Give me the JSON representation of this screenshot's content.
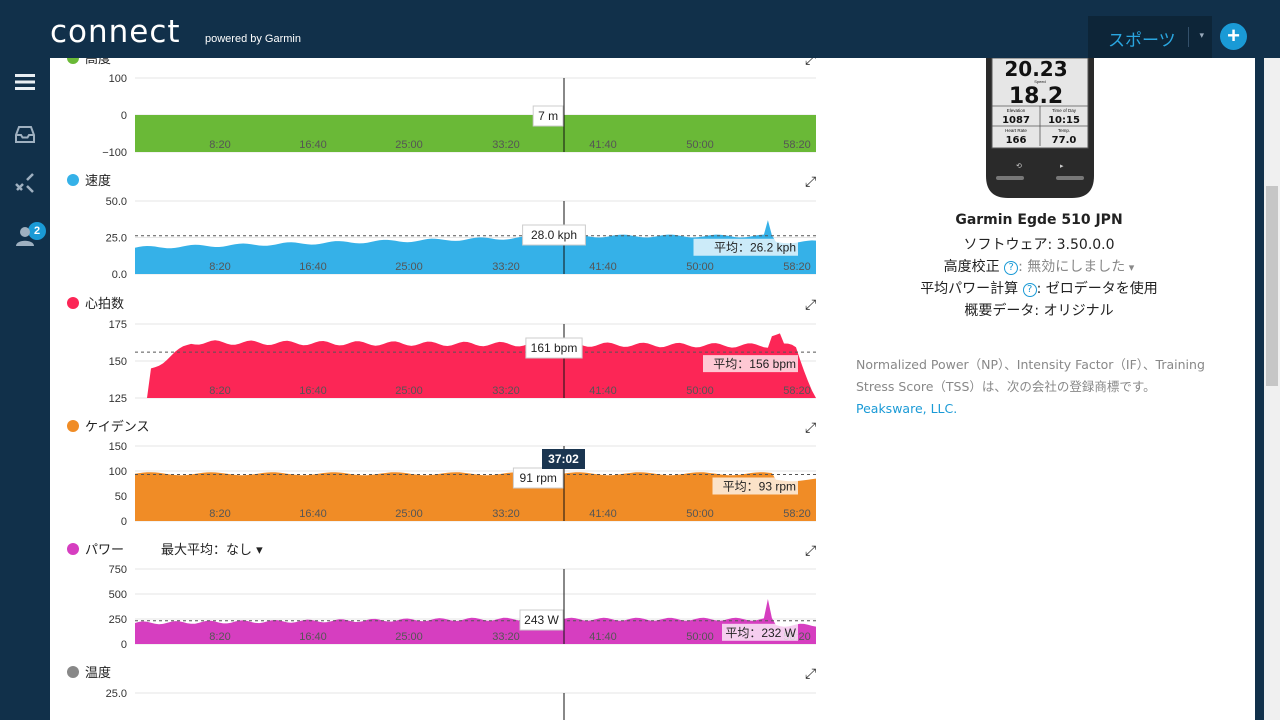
{
  "header": {
    "logo": "connect",
    "logo_sub": "powered by Garmin",
    "sports_label": "スポーツ",
    "plus_label": "+"
  },
  "sidenav": {
    "items": [
      "menu-icon",
      "inbox-icon",
      "connections-icon",
      "profile-icon"
    ],
    "badge_count": "2"
  },
  "cursor_time": "37:02",
  "charts": [
    {
      "id": "elevation",
      "title": "高度",
      "color": "#6ab937",
      "yticks": [
        "100",
        "0",
        "−100"
      ],
      "ylim": [
        -100,
        100
      ],
      "value_label": "7 m",
      "avg_label": "",
      "baseline": 0,
      "avg": null
    },
    {
      "id": "speed",
      "title": "速度",
      "color": "#35b1e8",
      "yticks": [
        "50.0",
        "25.0",
        "0.0"
      ],
      "ylim": [
        0,
        50
      ],
      "value_label": "28.0 kph",
      "avg_label": "平均：26.2 kph",
      "baseline": 0,
      "avg": 26.2
    },
    {
      "id": "heartrate",
      "title": "心拍数",
      "color": "#fc2656",
      "yticks": [
        "175",
        "150",
        "125"
      ],
      "ylim": [
        125,
        175
      ],
      "value_label": "161 bpm",
      "avg_label": "平均：156 bpm",
      "baseline": 125,
      "avg": 156
    },
    {
      "id": "cadence",
      "title": "ケイデンス",
      "color": "#f08c26",
      "yticks": [
        "150",
        "100",
        "50",
        "0"
      ],
      "ylim": [
        0,
        150
      ],
      "value_label": "91 rpm",
      "avg_label": "平均：93 rpm",
      "baseline": 0,
      "avg": 93
    },
    {
      "id": "power",
      "title": "パワー",
      "color": "#d63ec0",
      "subtitle": "最大平均：なし",
      "yticks": [
        "750",
        "500",
        "250",
        "0"
      ],
      "ylim": [
        0,
        750
      ],
      "value_label": "243 W",
      "avg_label": "平均：232 W",
      "baseline": 0,
      "avg": 232
    },
    {
      "id": "temperature",
      "title": "温度",
      "color": "#888888",
      "yticks": [
        "25.0"
      ],
      "ylim": [
        0,
        25
      ],
      "value_label": "",
      "avg_label": "",
      "baseline": 0,
      "avg": null
    }
  ],
  "xticks": [
    "8:20",
    "16:40",
    "25:00",
    "33:20",
    "41:40",
    "50:00",
    "58:20"
  ],
  "device": {
    "screen": {
      "line1": "20.23",
      "speed_label": "Speed",
      "speed": "18.2",
      "elev_label": "Elevation",
      "elev": "1087",
      "tod_label": "Time of Day",
      "tod": "10:15",
      "hr_label": "Heart Rate",
      "hr": "166",
      "temp_label": "Temp.",
      "temp": "77.0"
    },
    "name": "Garmin Egde 510 JPN",
    "software_label": "ソフトウェア:",
    "software": "3.50.0.0",
    "altcal_label": "高度校正",
    "altcal_value": ": 無効にしました",
    "avgpower_label": "平均パワー計算",
    "avgpower_value": ": ゼロデータを使用",
    "summary_label": "概要データ:",
    "summary_value": "オリジナル",
    "trademark": "Normalized Power（NP）、Intensity Factor（IF）、Training Stress Score（TSS）は、次の会社の登録商標です。",
    "trademark_link": "Peaksware, LLC."
  }
}
